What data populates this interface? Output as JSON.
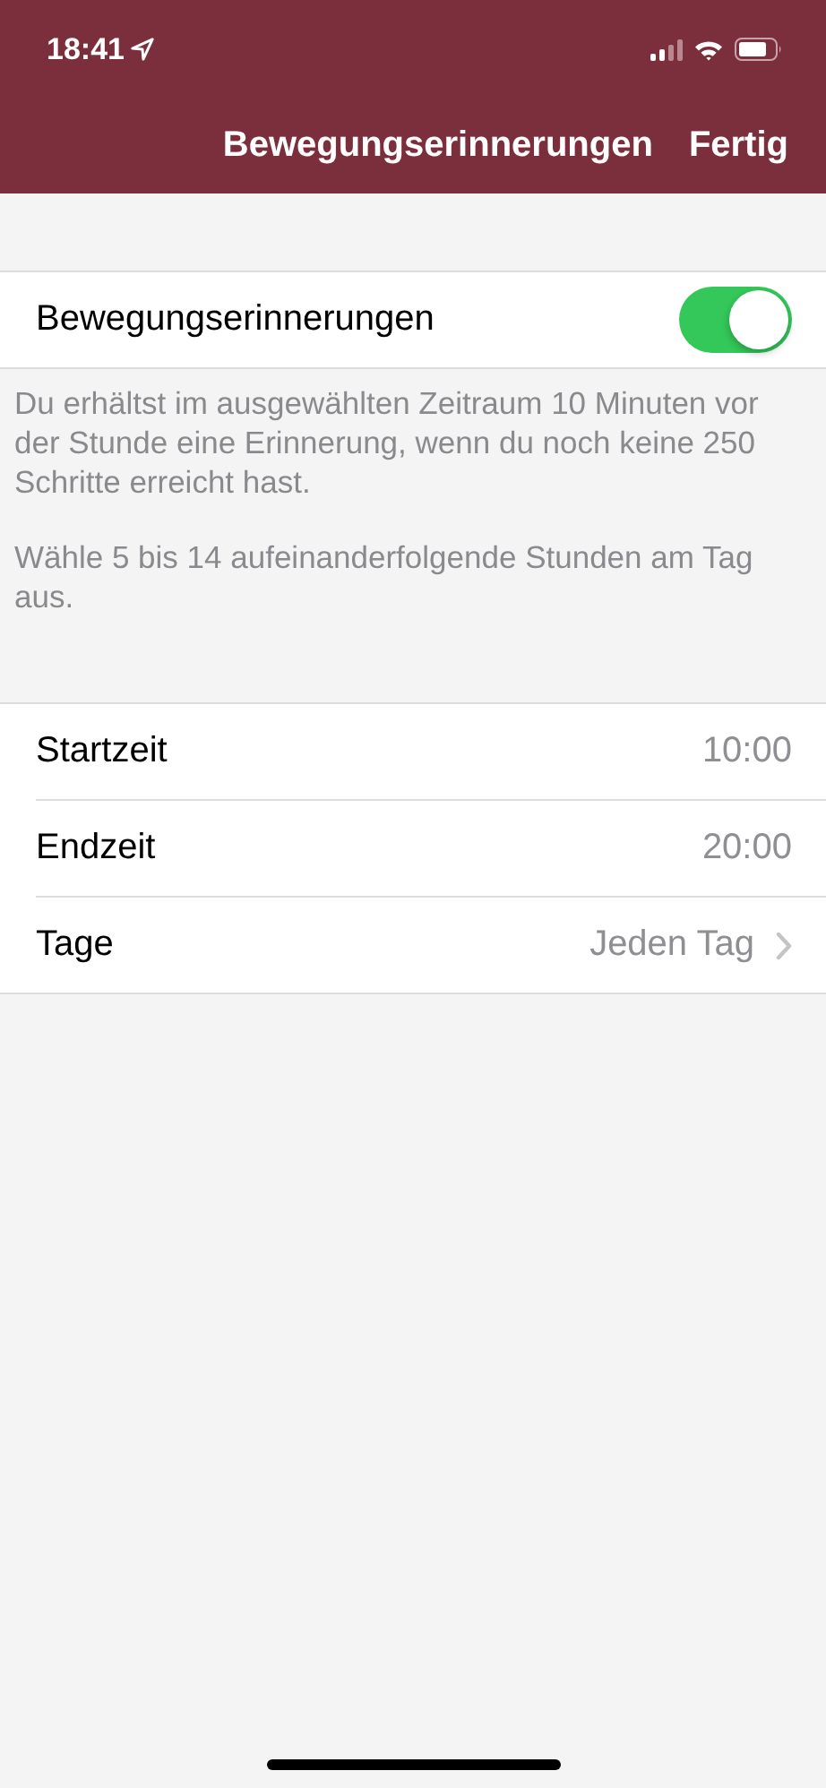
{
  "status_bar": {
    "time": "18:41"
  },
  "nav_bar": {
    "title": "Bewegungserinnerungen",
    "done_button": "Fertig"
  },
  "toggle": {
    "label": "Bewegungserinnerungen",
    "on": true
  },
  "footer_notes": [
    "Du erhältst im ausgewählten Zeitraum 10 Minuten vor der Stunde eine Erinnerung, wenn du noch keine 250 Schritte erreicht hast.",
    "Wähle 5 bis 14 aufeinanderfolgende Stunden am Tag aus."
  ],
  "settings": [
    {
      "label": "Startzeit",
      "value": "10:00",
      "kind": "value"
    },
    {
      "label": "Endzeit",
      "value": "20:00",
      "kind": "value"
    },
    {
      "label": "Tage",
      "value": "Jeden Tag",
      "kind": "disclosure"
    }
  ]
}
